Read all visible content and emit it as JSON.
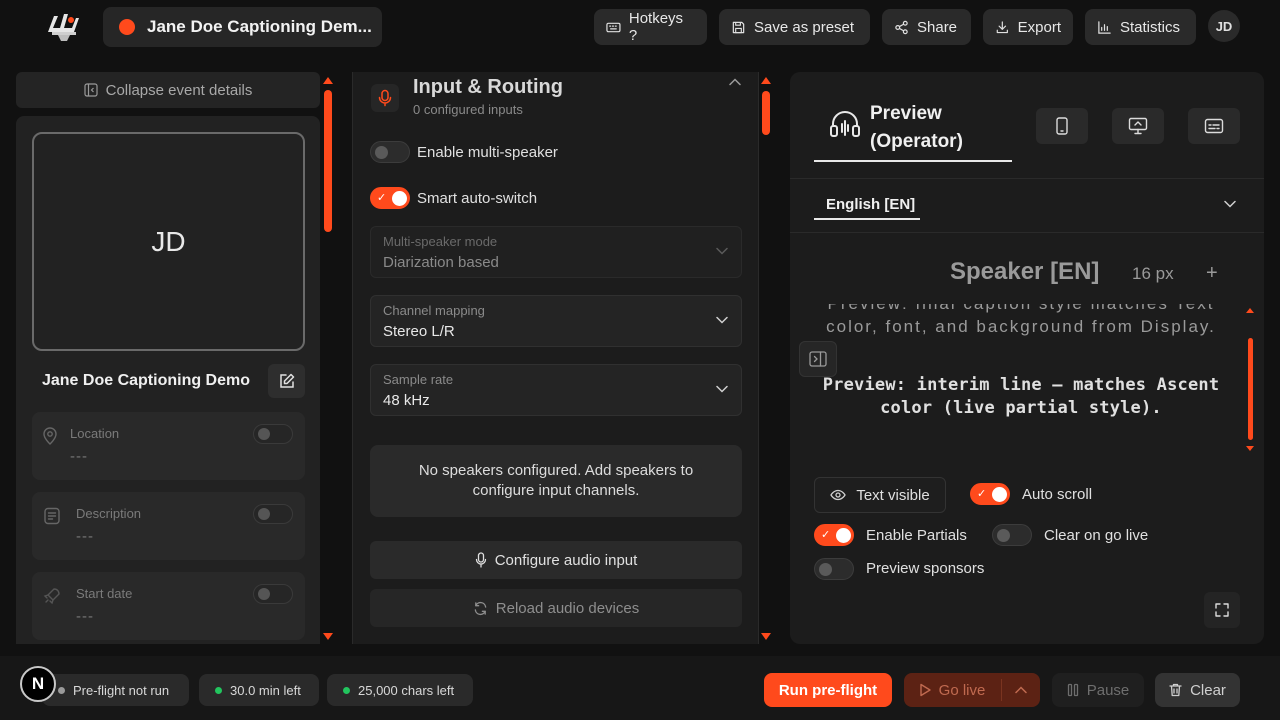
{
  "header": {
    "event_title": "Jane Doe Captioning Dem...",
    "buttons": {
      "hotkeys": "Hotkeys ?",
      "save_preset": "Save as preset",
      "share": "Share",
      "export": "Export",
      "statistics": "Statistics"
    },
    "user_initials": "JD",
    "accent_color": "#ff4a1c"
  },
  "event_panel": {
    "collapse_label": "Collapse event details",
    "avatar_initials": "JD",
    "event_name": "Jane Doe Captioning Demo",
    "fields": [
      {
        "label": "Location",
        "value": "---",
        "icon": "map-pin-icon"
      },
      {
        "label": "Description",
        "value": "---",
        "icon": "document-icon"
      },
      {
        "label": "Start date",
        "value": "---",
        "icon": "rocket-icon"
      }
    ]
  },
  "input_routing": {
    "title": "Input & Routing",
    "subtitle": "0 configured inputs",
    "toggles": [
      {
        "label": "Enable multi-speaker",
        "on": false
      },
      {
        "label": "Smart auto-switch",
        "on": true
      }
    ],
    "selects": [
      {
        "label": "Multi-speaker mode",
        "value": "Diarization based",
        "disabled": true
      },
      {
        "label": "Channel mapping",
        "value": "Stereo L/R",
        "disabled": false
      },
      {
        "label": "Sample rate",
        "value": "48 kHz",
        "disabled": false
      }
    ],
    "empty_note": "No speakers configured. Add speakers to configure input channels.",
    "configure_btn": "Configure audio input",
    "reload_btn": "Reload audio devices"
  },
  "preview": {
    "tab_title": "Preview (Operator)",
    "language": "English [EN]",
    "speaker_label": "Speaker [EN]",
    "font_size": "16 px",
    "plus": "+",
    "final_caption": "Preview: final caption style matches Text color, font, and background from Display.",
    "interim_caption": "Preview: interim line — matches Ascent color (live partial style).",
    "text_visible_label": "Text visible",
    "toggles": [
      {
        "label": "Auto scroll",
        "on": true
      },
      {
        "label": "Enable Partials",
        "on": true
      },
      {
        "label": "Clear on go live",
        "on": false
      },
      {
        "label": "Preview sponsors",
        "on": false
      }
    ]
  },
  "bottom_bar": {
    "badge": "N",
    "status": [
      {
        "label": "Pre-flight not run",
        "color": "#9a9a9a"
      },
      {
        "label": "30.0 min left",
        "color": "#22c55e"
      },
      {
        "label": "25,000 chars left",
        "color": "#22c55e"
      }
    ],
    "run_preflight": "Run pre-flight",
    "go_live": "Go live",
    "pause": "Pause",
    "clear": "Clear"
  }
}
